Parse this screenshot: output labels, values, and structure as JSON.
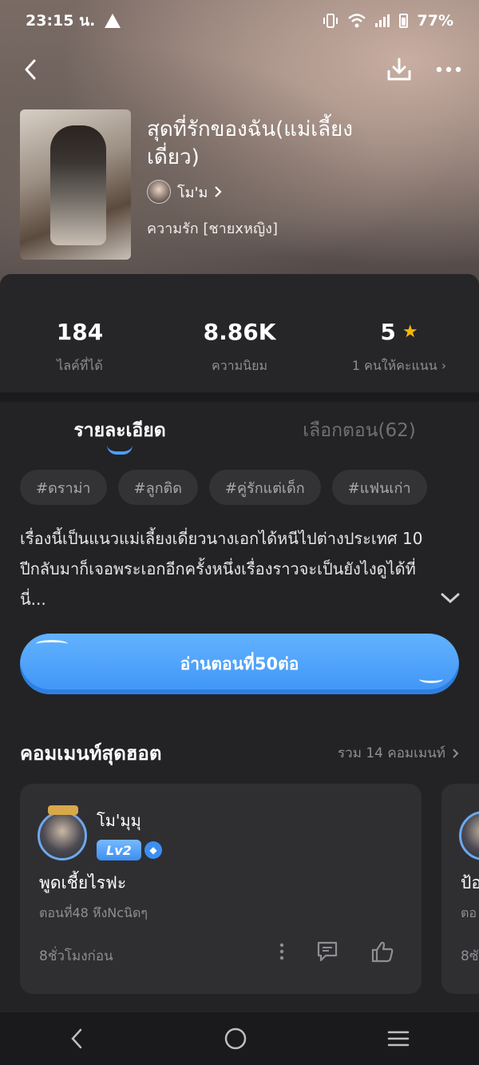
{
  "status": {
    "time": "23:15 น.",
    "battery": "77%"
  },
  "book": {
    "title": "สุดที่รักของฉัน(แม่เลี้ยงเดี่ยว)",
    "author": "โม'ม",
    "genre": "ความรัก [ชายxหญิง]"
  },
  "stats": [
    {
      "value": "184",
      "label": "ไลค์ที่ได้"
    },
    {
      "value": "8.86K",
      "label": "ความนิยม"
    },
    {
      "value": "5",
      "label": "1 คนให้คะแนน"
    }
  ],
  "tabs": [
    {
      "label": "รายละเอียด",
      "active": true
    },
    {
      "label": "เลือกตอน(62)",
      "active": false
    }
  ],
  "tags": [
    "#ดราม่า",
    "#ลูกติด",
    "#คู่รักแต่เด็ก",
    "#แฟนเก่า"
  ],
  "synopsis": "เรื่องนี้เป็นแนวแม่เลี้ยงเดี่ยวนางเอกได้หนีไปต่างประเทศ 10 ปีกลับมาก็เจอพระเอกอีกครั้งหนึ่งเรื่องราวจะเป็นยังไงดูได้ที่นี่...",
  "read_button": "อ่านตอนที่50ต่อ",
  "comments": {
    "title": "คอมเมนท์สุดฮอต",
    "total": "รวม 14 คอมเมนท์",
    "items": [
      {
        "user": "โม'มุมุ",
        "level": "Lv2",
        "text": "พูดเชี้ยไรฟะ",
        "chapter": "ตอนที่48 หึงNcนิดๆ",
        "time": "8ชั่วโมงก่อน"
      },
      {
        "text": "ป้อ",
        "chapter": "ตอ",
        "time": "8ซั"
      }
    ]
  },
  "colors": {
    "accent": "#4aa1ff",
    "star": "#f5b800",
    "background": "#232325"
  }
}
